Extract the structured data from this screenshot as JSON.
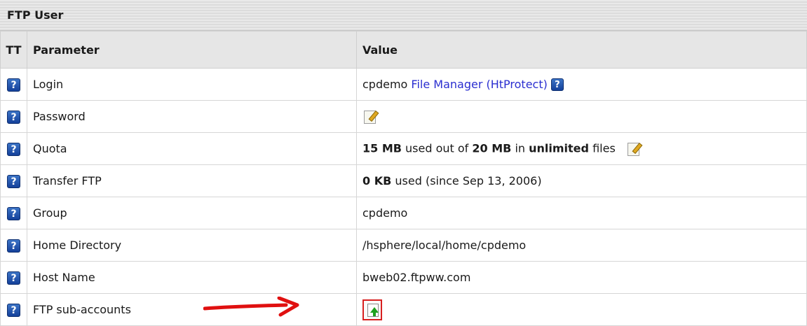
{
  "panel": {
    "title": "FTP User"
  },
  "headers": {
    "tt": "TT",
    "parameter": "Parameter",
    "value": "Value"
  },
  "rows": [
    {
      "param": "Login",
      "value_text": "cpdemo",
      "link": "File Manager (HtProtect)"
    },
    {
      "param": "Password",
      "action": "edit-icon"
    },
    {
      "param": "Quota",
      "used": "15 MB",
      "used_out_of": " used out of ",
      "limit": "20 MB",
      "in_text": " in ",
      "files_limit": "unlimited",
      "files_text": " files",
      "action": "edit-icon"
    },
    {
      "param": "Transfer FTP",
      "amount": "0 KB",
      "suffix": " used (since Sep 13, 2006)"
    },
    {
      "param": "Group",
      "value": "cpdemo"
    },
    {
      "param": "Home Directory",
      "value": "/hsphere/local/home/cpdemo"
    },
    {
      "param": "Host Name",
      "value": "bweb02.ftpww.com"
    },
    {
      "param": "FTP sub-accounts",
      "action": "add-icon"
    }
  ],
  "icons": {
    "help": "?",
    "help_icon_name": "help-icon"
  },
  "colors": {
    "link": "#2b2fd0",
    "arrow": "#e01010",
    "highlight_box": "#d82020"
  }
}
